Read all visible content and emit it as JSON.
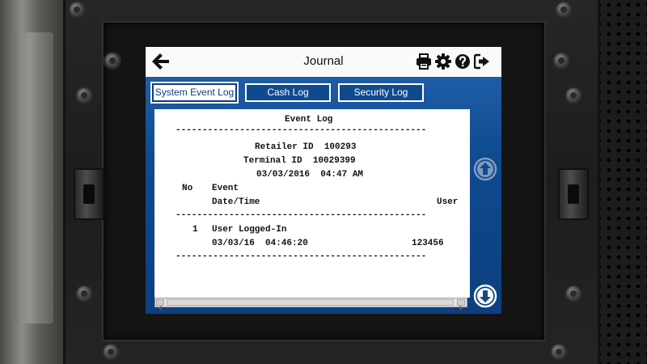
{
  "window": {
    "title": "Journal"
  },
  "toolbar": {
    "icons": [
      "print-icon",
      "gear-icon",
      "help-icon",
      "logout-icon"
    ]
  },
  "tabs": [
    {
      "label": "System Event Log",
      "active": true
    },
    {
      "label": "Cash Log",
      "active": false
    },
    {
      "label": "Security Log",
      "active": false
    }
  ],
  "report": {
    "heading": "Event Log",
    "separator": "-----------------------------------------------",
    "retailer_line": "Retailer ID  100293",
    "terminal_line": "Terminal ID  10029399",
    "datetime_line": "03/03/2016  04:47 AM",
    "col_no": "No",
    "col_event": "Event",
    "col_datetime": "Date/Time",
    "col_user": "User",
    "entries": [
      {
        "no": "1",
        "event": "User Logged-In",
        "datetime": "03/03/16  04:46:20",
        "user": "123456"
      }
    ]
  },
  "scroll": {
    "up_enabled": false,
    "down_enabled": true
  },
  "colors": {
    "frame_blue": "#0f4a8f",
    "active_tab_text": "#0d3e7d",
    "disabled_arrow": "#7e9cc0"
  }
}
